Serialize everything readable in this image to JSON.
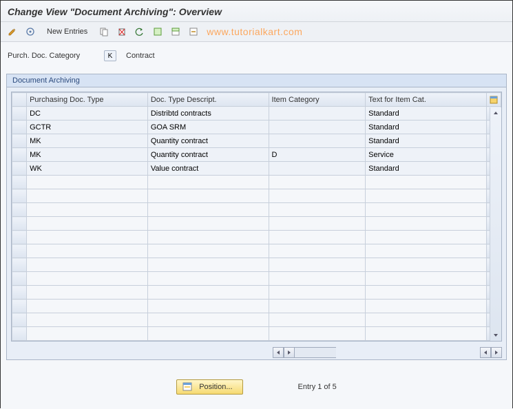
{
  "title": "Change View \"Document Archiving\": Overview",
  "toolbar": {
    "new_entries": "New Entries"
  },
  "watermark": "www.tutorialkart.com",
  "header": {
    "label": "Purch. Doc. Category",
    "value_code": "K",
    "value_desc": "Contract"
  },
  "panel": {
    "title": "Document Archiving"
  },
  "grid": {
    "columns": [
      "Purchasing Doc. Type",
      "Doc. Type Descript.",
      "Item Category",
      "Text for Item Cat."
    ],
    "rows": [
      {
        "c0": "DC",
        "c1": "Distribtd contracts",
        "c2": "",
        "c3": "Standard"
      },
      {
        "c0": "GCTR",
        "c1": "GOA SRM",
        "c2": "",
        "c3": "Standard"
      },
      {
        "c0": "MK",
        "c1": "Quantity contract",
        "c2": "",
        "c3": "Standard"
      },
      {
        "c0": "MK",
        "c1": "Quantity contract",
        "c2": "D",
        "c3": "Service"
      },
      {
        "c0": "WK",
        "c1": "Value contract",
        "c2": "",
        "c3": "Standard"
      }
    ],
    "empty_rows": 12
  },
  "footer": {
    "position_label": "Position...",
    "entry_text": "Entry 1 of 5"
  }
}
